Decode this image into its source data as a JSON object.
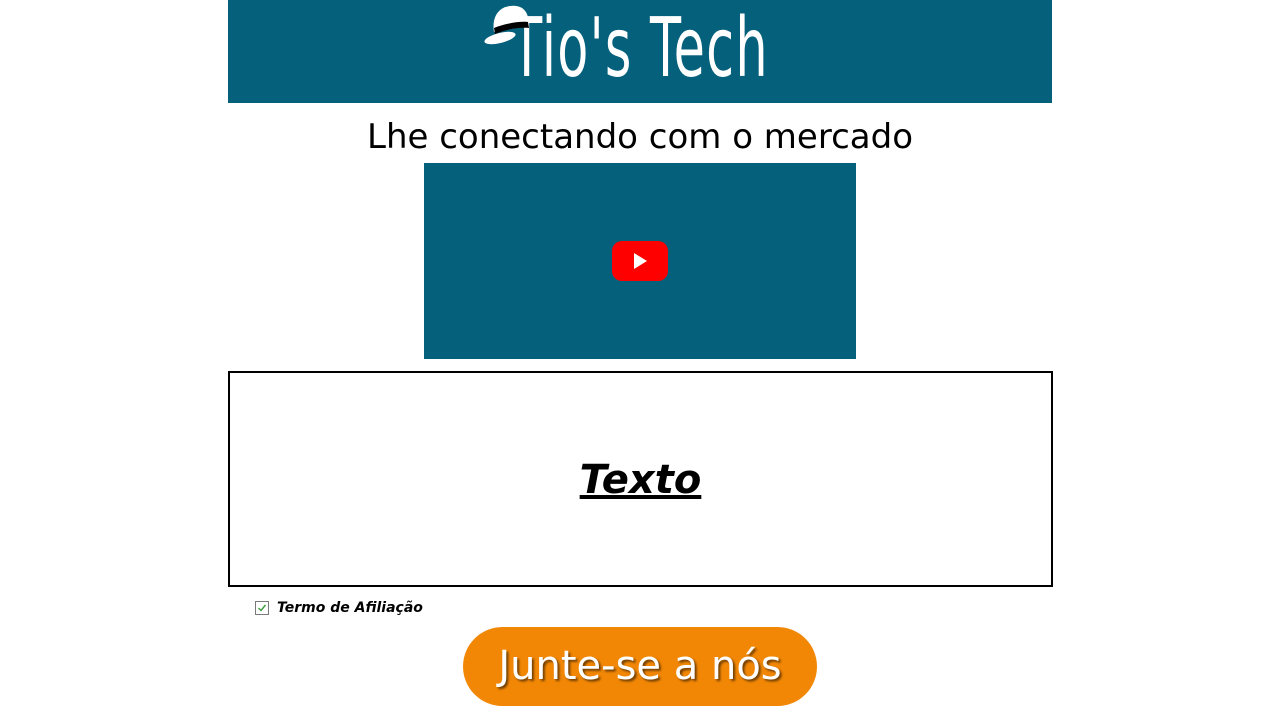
{
  "header": {
    "brand": "Tio's Tech",
    "hat_icon": "fedora-hat-icon",
    "background_color": "#05607c"
  },
  "tagline": "Lhe conectando com o mercado",
  "video": {
    "play_icon": "youtube-play-icon",
    "background_color": "#05607c",
    "play_color": "#ff0000"
  },
  "content_box": {
    "label": "Texto"
  },
  "terms": {
    "label": "Termo de Afiliação",
    "checked": true
  },
  "cta": {
    "label": "Junte-se a nós",
    "color": "#f28705"
  }
}
